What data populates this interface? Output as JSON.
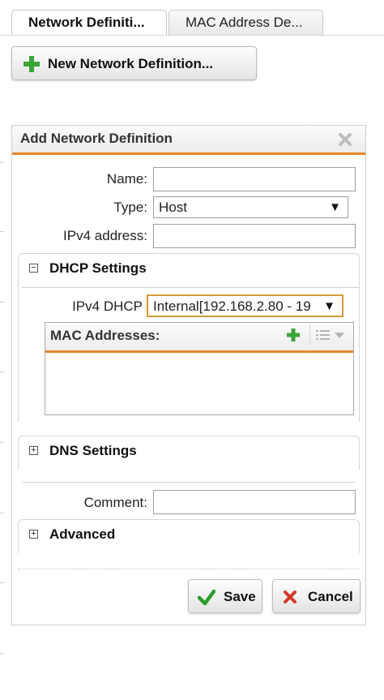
{
  "tabs": [
    {
      "label": "Network Definiti...",
      "active": true
    },
    {
      "label": "MAC Address De...",
      "active": false
    }
  ],
  "toolbar": {
    "new_button_label": "New Network Definition...",
    "new_button_icon": "plus-icon"
  },
  "dialog": {
    "title": "Add Network Definition",
    "close_icon": "close-icon",
    "fields": {
      "name": {
        "label": "Name:",
        "value": ""
      },
      "type": {
        "label": "Type:",
        "value": "Host"
      },
      "ipv4": {
        "label": "IPv4 address:",
        "value": ""
      },
      "comment": {
        "label": "Comment:",
        "value": ""
      }
    },
    "dhcp_section": {
      "title": "DHCP Settings",
      "expanded": true,
      "ipv4_dhcp_label": "IPv4 DHCP",
      "ipv4_dhcp_value": "Internal[192.168.2.80 - 19",
      "mac_list": {
        "title": "MAC Addresses:",
        "items": []
      }
    },
    "dns_section": {
      "title": "DNS Settings",
      "expanded": false
    },
    "advanced_section": {
      "title": "Advanced",
      "expanded": false
    },
    "buttons": {
      "save": "Save",
      "cancel": "Cancel"
    }
  },
  "colors": {
    "accent": "#e8862a",
    "plus_green": "#3aa53a",
    "check_green": "#2e9c2e",
    "cancel_red": "#d23a2a"
  }
}
